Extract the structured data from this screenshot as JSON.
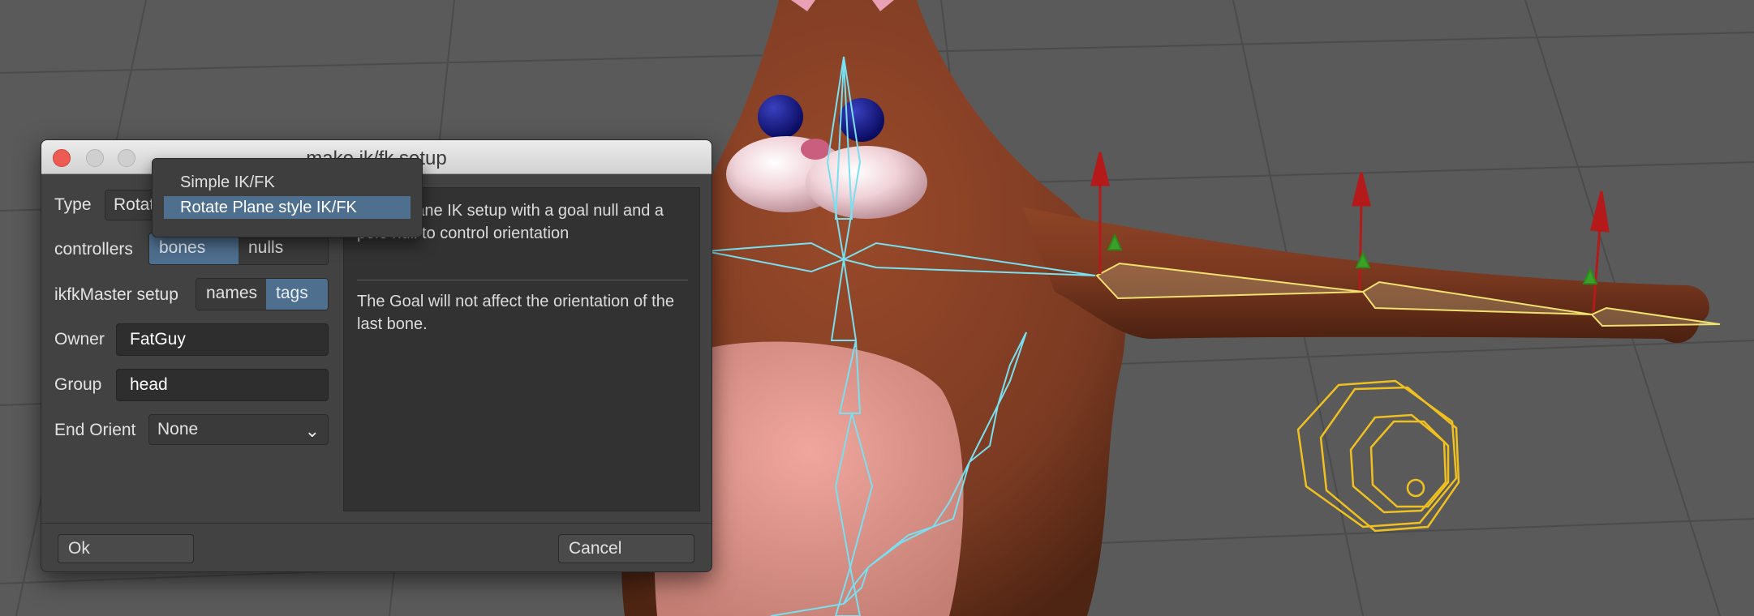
{
  "dialog": {
    "title": "make ik/fk setup",
    "type_label": "Type",
    "type_value": "Rotat",
    "controllers_label": "controllers",
    "controllers_options": [
      "bones",
      "nulls"
    ],
    "controllers_selected": "bones",
    "master_label": "ikfkMaster setup",
    "master_options": [
      "names",
      "tags"
    ],
    "master_selected": "tags",
    "owner_label": "Owner",
    "owner_value": "FatGuy",
    "group_label": "Group",
    "group_value": "head",
    "end_orient_label": "End Orient",
    "end_orient_value": "None",
    "info_p1": "rotate plane IK setup with a goal null and a pole null to control orientation",
    "info_p2": "The Goal will not affect the orientation of the last bone.",
    "ok_label": "Ok",
    "cancel_label": "Cancel"
  },
  "type_menu": {
    "items": [
      "Simple IK/FK",
      "Rotate Plane style IK/FK"
    ],
    "selected": "Rotate Plane style IK/FK"
  },
  "colors": {
    "viewport_bg": "#5a5a5a",
    "skin": "#7a3a22",
    "belly": "#d9958c",
    "bone_cyan": "#78e0f0",
    "selected_bones": "#f0e070",
    "controller_yellow": "#f0c020",
    "accent_blue": "#4f6f8f",
    "close_red": "#ee5b52"
  }
}
